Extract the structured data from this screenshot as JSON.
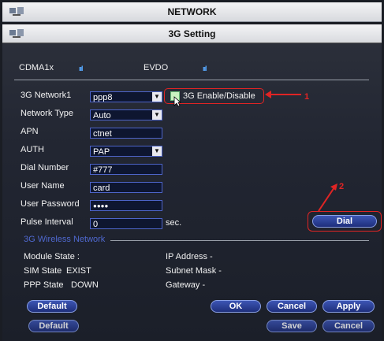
{
  "window": {
    "title": "NETWORK"
  },
  "dialog": {
    "title": "3G Setting",
    "signals": [
      {
        "name": "CDMA1x",
        "bars": "ııl"
      },
      {
        "name": "EVDO",
        "bars": "ııl"
      }
    ],
    "form": {
      "network": {
        "label": "3G Network1",
        "value": "ppp8"
      },
      "enable": {
        "label": "3G Enable/Disable"
      },
      "network_type": {
        "label": "Network Type",
        "value": "Auto"
      },
      "apn": {
        "label": "APN",
        "value": "ctnet"
      },
      "auth": {
        "label": "AUTH",
        "value": "PAP"
      },
      "dial_number": {
        "label": "Dial Number",
        "value": "#777"
      },
      "user_name": {
        "label": "User Name",
        "value": "card"
      },
      "user_password": {
        "label": "User Password",
        "value": "●●●●"
      },
      "pulse_interval": {
        "label": "Pulse Interval",
        "value": "0",
        "unit": "sec."
      }
    },
    "dial_button": "Dial",
    "wireless": {
      "section_title": "3G Wireless Network",
      "module_state": "Module State :",
      "sim_state_label": "SIM State",
      "sim_state_value": "EXIST",
      "ppp_state_label": "PPP State",
      "ppp_state_value": "DOWN",
      "ip_address": "IP Address -",
      "subnet_mask": "Subnet Mask -",
      "gateway": "Gateway -"
    },
    "buttons": {
      "default": "Default",
      "ok": "OK",
      "cancel": "Cancel",
      "apply": "Apply"
    }
  },
  "background_buttons": {
    "default": "Default",
    "save": "Save",
    "cancel": "Cancel"
  },
  "annotations": {
    "one": "1",
    "two": "2"
  },
  "colors": {
    "accent": "#2f46a6",
    "annotation": "#e02424"
  }
}
